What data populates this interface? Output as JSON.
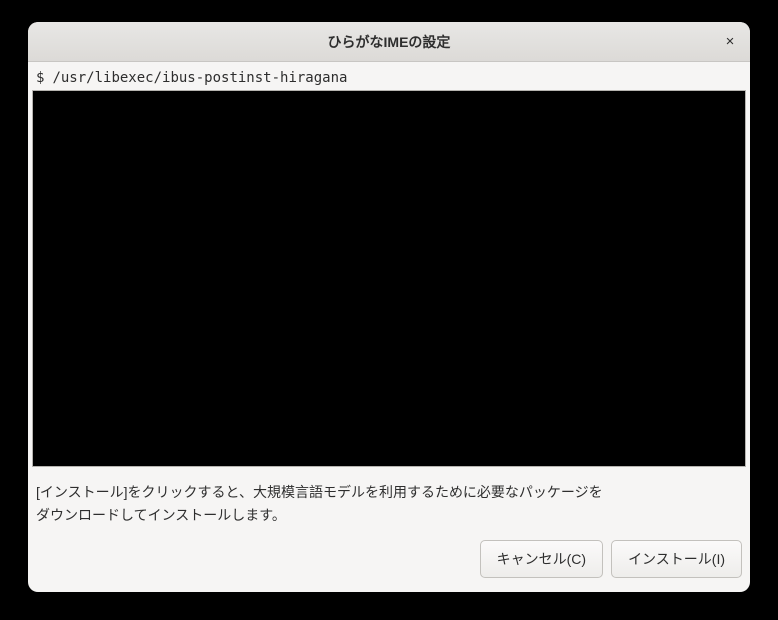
{
  "dialog": {
    "title": "ひらがなIMEの設定",
    "close_symbol": "×"
  },
  "terminal": {
    "prompt": "$",
    "command": "/usr/libexec/ibus-postinst-hiragana"
  },
  "message": {
    "line1": "[インストール]をクリックすると、大規模言語モデルを利用するために必要なパッケージを",
    "line2": "ダウンロードしてインストールします。"
  },
  "buttons": {
    "cancel": "キャンセル(C)",
    "install": "インストール(I)"
  }
}
